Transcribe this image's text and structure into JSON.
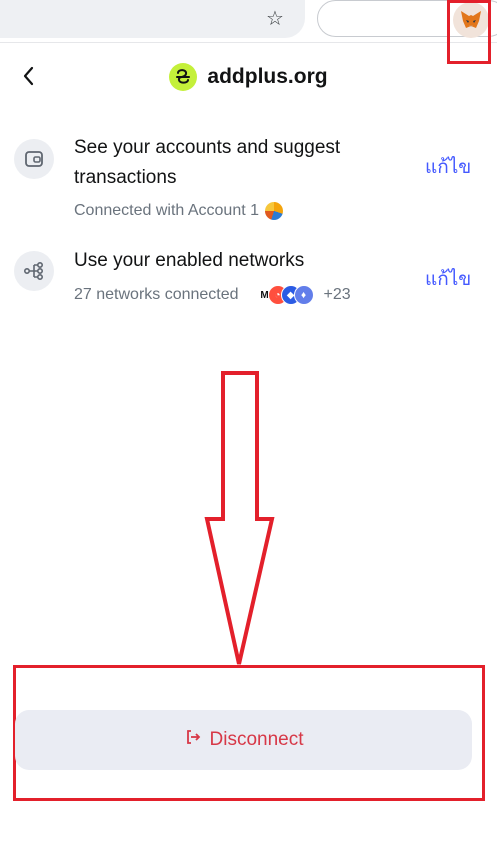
{
  "browser": {
    "bookmark_icon": "star-icon",
    "extension_icon": "metamask-fox-icon"
  },
  "header": {
    "back_icon": "chevron-left-icon",
    "site_name": "addplus.org",
    "logo_color": "#c4f03a"
  },
  "permissions": [
    {
      "icon": "wallet-icon",
      "title": "See your accounts and suggest transactions",
      "subtitle": "Connected with Account 1",
      "edit_label": "แก้ไข"
    },
    {
      "icon": "network-icon",
      "title": "Use your enabled networks",
      "subtitle": "27 networks connected",
      "extra_count": "+23",
      "edit_label": "แก้ไข"
    }
  ],
  "disconnect": {
    "label": "Disconnect",
    "icon": "logout-icon",
    "color": "#d73847"
  },
  "colors": {
    "accent_link": "#4459ff",
    "annotation_red": "#e3202b"
  }
}
